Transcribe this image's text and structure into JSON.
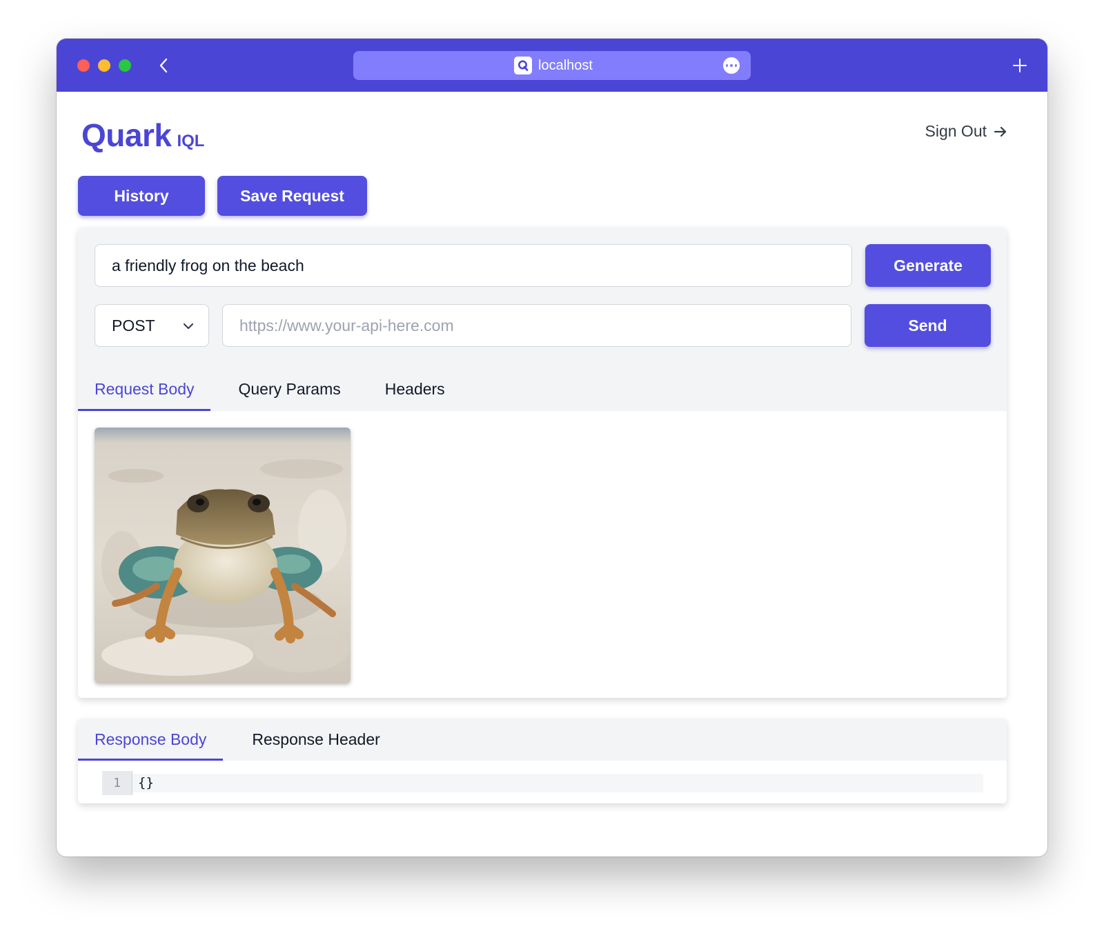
{
  "browser": {
    "url": "localhost",
    "accent_color": "#4b45d6",
    "urlbar_color": "#827dfd",
    "icons": [
      "back-chevron-icon",
      "site-q-icon",
      "more-icon",
      "plus-icon"
    ]
  },
  "header": {
    "logo_main": "Quark",
    "logo_sub": "IQL",
    "sign_out_label": "Sign Out"
  },
  "toolbar": {
    "history_label": "History",
    "save_label": "Save Request"
  },
  "request": {
    "prompt_value": "a friendly frog on the beach",
    "generate_label": "Generate",
    "method": "POST",
    "url_placeholder": "https://www.your-api-here.com",
    "send_label": "Send",
    "tabs": [
      {
        "label": "Request Body",
        "active": true
      },
      {
        "label": "Query Params",
        "active": false
      },
      {
        "label": "Headers",
        "active": false
      }
    ],
    "body_image": "frog-on-sand-photo"
  },
  "response": {
    "tabs": [
      {
        "label": "Response Body",
        "active": true
      },
      {
        "label": "Response Header",
        "active": false
      }
    ],
    "line_number": "1",
    "code": "{}"
  }
}
